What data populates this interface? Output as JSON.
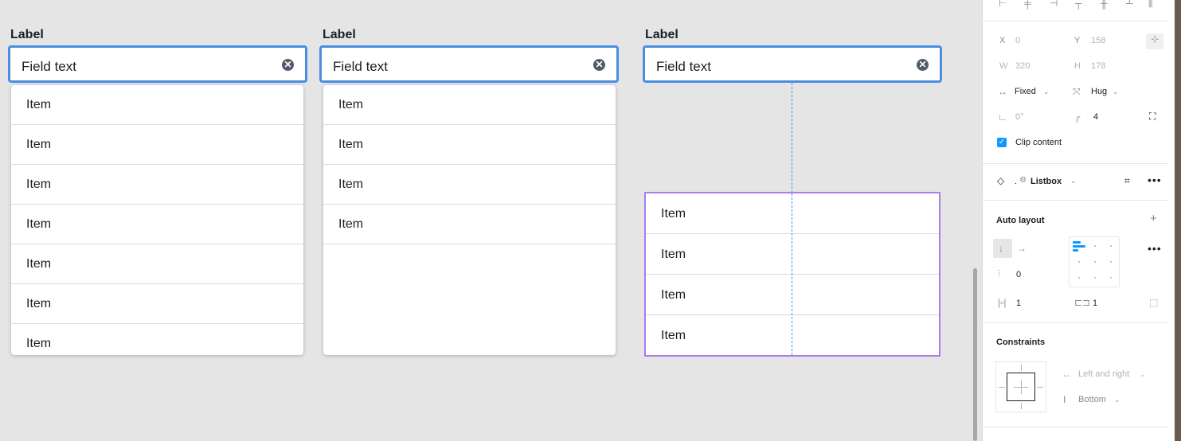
{
  "combos": [
    {
      "label": "Label",
      "field_text": "Field text",
      "items": [
        "Item",
        "Item",
        "Item",
        "Item",
        "Item",
        "Item",
        "Item"
      ]
    },
    {
      "label": "Label",
      "field_text": "Field text",
      "items": [
        "Item",
        "Item",
        "Item",
        "Item"
      ]
    },
    {
      "label": "Label",
      "field_text": "Field text",
      "items": [
        "Item",
        "Item",
        "Item",
        "Item"
      ]
    }
  ],
  "clear_glyph": "✕",
  "panel": {
    "x_label": "X",
    "x_value": "0",
    "y_label": "Y",
    "y_value": "158",
    "w_label": "W",
    "w_value": "320",
    "h_label": "H",
    "h_value": "178",
    "width_mode": "Fixed",
    "height_mode": "Hug",
    "rotation": "0°",
    "radius": "4",
    "clip_content": "Clip content",
    "component_name": "Listbox",
    "component_prefix": ".",
    "auto_layout_title": "Auto layout",
    "gap": "0",
    "padding_h": "1",
    "padding_v": "1",
    "constraints_title": "Constraints",
    "horizontal_constraint": "Left and right",
    "vertical_constraint": "Bottom"
  },
  "colors": {
    "focus_border": "#4a8ee0",
    "selection": "#a97cf0",
    "guide": "#2d9cf2",
    "accent": "#0d99ff"
  }
}
